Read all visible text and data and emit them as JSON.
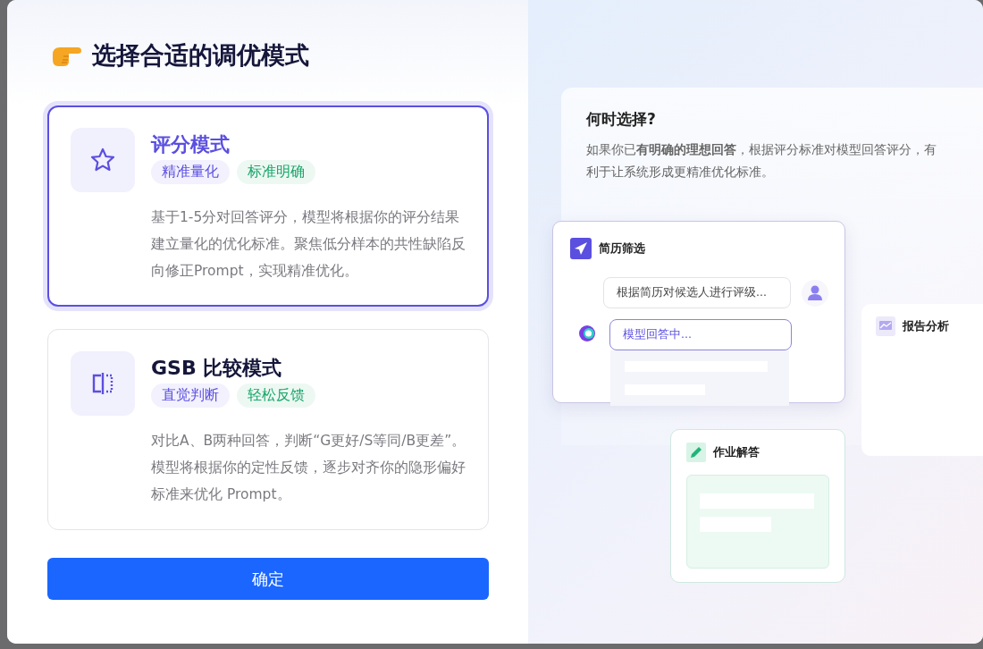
{
  "title": "选择合适的调优模式",
  "modes": [
    {
      "name": "评分模式",
      "kind": "star",
      "selected": true,
      "tags": [
        {
          "label": "精准量化",
          "color": "#5b4fe0"
        },
        {
          "label": "标准明确",
          "color": "#17a567"
        }
      ],
      "description": "基于1-5分对回答评分，模型将根据你的评分结果建立量化的优化标准。聚焦低分样本的共性缺陷反向修正Prompt，实现精准优化。"
    },
    {
      "name": "GSB 比较模式",
      "kind": "compare",
      "selected": false,
      "tags": [
        {
          "label": "直觉判断",
          "color": "#5b4fe0"
        },
        {
          "label": "轻松反馈",
          "color": "#17a567"
        }
      ],
      "description": "对比A、B两种回答，判断“G更好/S等同/B更差”。模型将根据你的定性反馈，逐步对齐你的隐形偏好标准来优化 Prompt。"
    }
  ],
  "confirm_button": "确定",
  "info": {
    "heading": "何时选择?",
    "text": "如果你已**有明确的理想回答**，根据评分标准对模型回答评分，有利于让系统形成更精准优化标准。"
  },
  "illustration": {
    "chat_card": {
      "title": "简历筛选",
      "user_message": "根据简历对候选人进行评级...",
      "model_message": "模型回答中..."
    },
    "report_card": {
      "title": "报告分析"
    },
    "homework_card": {
      "title": "作业解答"
    }
  }
}
